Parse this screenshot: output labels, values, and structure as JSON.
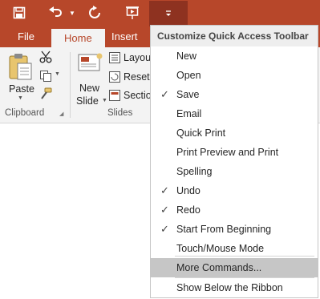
{
  "qat": {
    "buttons": [
      "save-icon",
      "undo-icon",
      "redo-icon",
      "slideshow-icon",
      "customize-qat-icon"
    ]
  },
  "tabs": [
    "File",
    "Home",
    "Insert"
  ],
  "active_tab": "Home",
  "ribbon": {
    "paste_label": "Paste",
    "new_slide_label": "New",
    "new_slide_label2": "Slide",
    "layout_label": "Layou",
    "reset_label": "Reset",
    "section_label": "Sectio",
    "group_clipboard": "Clipboard",
    "group_slides": "Slides"
  },
  "menu": {
    "title": "Customize Quick Access Toolbar",
    "items": [
      {
        "label": "New",
        "checked": false
      },
      {
        "label": "Open",
        "checked": false
      },
      {
        "label": "Save",
        "checked": true
      },
      {
        "label": "Email",
        "checked": false
      },
      {
        "label": "Quick Print",
        "checked": false
      },
      {
        "label": "Print Preview and Print",
        "checked": false
      },
      {
        "label": "Spelling",
        "checked": false
      },
      {
        "label": "Undo",
        "checked": true
      },
      {
        "label": "Redo",
        "checked": true
      },
      {
        "label": "Start From Beginning",
        "checked": true
      },
      {
        "label": "Touch/Mouse Mode",
        "checked": false
      }
    ],
    "more_commands": "More Commands...",
    "show_below": "Show Below the Ribbon"
  }
}
